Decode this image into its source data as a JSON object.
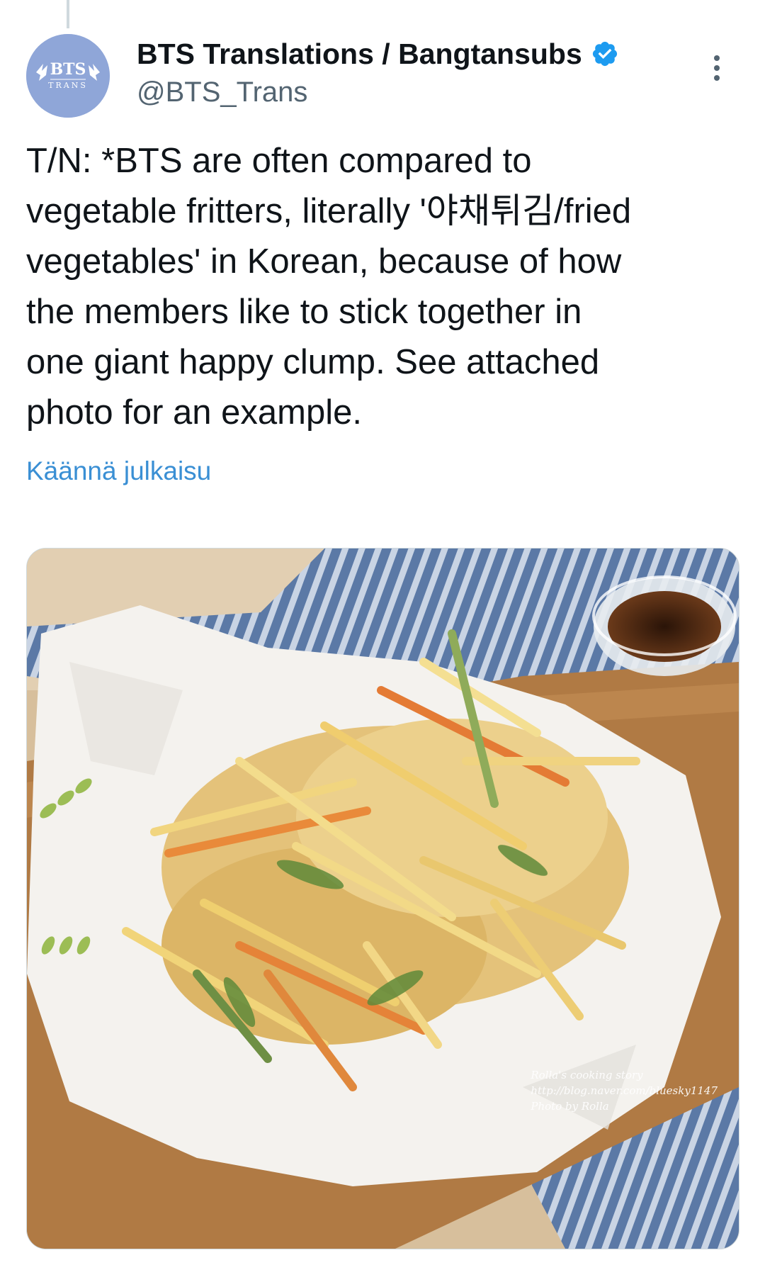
{
  "author": {
    "display_name": "BTS Translations / Bangtansubs",
    "handle": "@BTS_Trans",
    "verified": true,
    "avatar_icon": "bts-trans-logo-icon",
    "avatar_text": "BTS",
    "avatar_subtext": "TRANS"
  },
  "tweet": {
    "text": "T/N: *BTS are often compared to\nvegetable fritters, literally '야채튀김/fried\nvegetables' in Korean, because of how\nthe members like to stick together in\none giant happy clump. See attached\nphoto for an example.",
    "translate_label": "Käännä julkaisu"
  },
  "media": {
    "watermark": {
      "line1": "Rolla's cooking story",
      "line2": "http://blog.naver.com/bluesky1147",
      "line3": "Photo by Rolla"
    }
  },
  "icons": {
    "more": "more-vertical-icon",
    "verified": "verified-badge-icon"
  },
  "colors": {
    "accent": "#1d9bf0",
    "link": "#3a8fd4",
    "secondary_text": "#536471",
    "avatar_bg": "#8fa6d8"
  }
}
